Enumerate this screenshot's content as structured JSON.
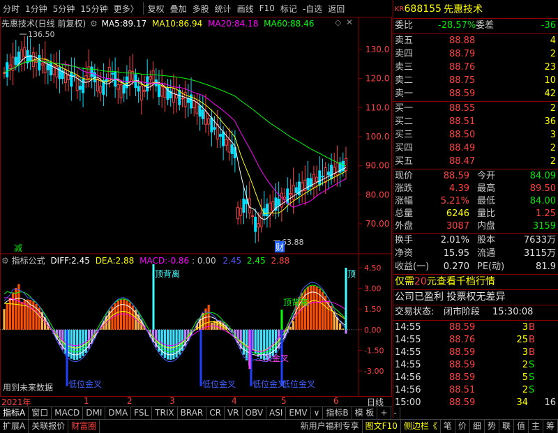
{
  "toolbar": {
    "items": [
      "分时",
      "1分钟",
      "5分钟",
      "15分钟",
      "更多〉",
      "复权",
      "叠加",
      "多股",
      "统计",
      "画线",
      "F10",
      "标记",
      "-自选",
      "返回"
    ],
    "colors": {
      "bg": "#000000",
      "border": "#8b0000"
    }
  },
  "main_chart": {
    "title": "先惠技术(日线 前复权)",
    "ma": [
      {
        "label": "MA5:",
        "value": "89.17",
        "color": "#ffffff"
      },
      {
        "label": "MA10:",
        "value": "86.94",
        "color": "#ffff00"
      },
      {
        "label": "MA20:",
        "value": "84.18",
        "color": "#ff00ff"
      },
      {
        "label": "MA60:",
        "value": "88.46",
        "color": "#00ff00"
      }
    ],
    "y_ticks": [
      "130.0",
      "120.0",
      "110.0",
      "100.0",
      "90.00",
      "80.00",
      "70.00"
    ],
    "high_label": "136.50",
    "low_label": "63.88",
    "marker_jian": "减",
    "marker_cai": "财"
  },
  "indicator": {
    "name": "指标公式",
    "diff_label": "DIFF:",
    "diff": "2.45",
    "dea_label": "DEA:",
    "dea": "2.88",
    "macd_label": "MACD:",
    "macd": "-0.86",
    "zero": ":  0.00",
    "v1": "2.45",
    "v2": "2.45",
    "v3": "2.88",
    "y_ticks": [
      "4.50",
      "3.00",
      "1.50",
      "0.00",
      "-1.50",
      "-3.00"
    ],
    "labels": {
      "top_div1": "顶背离",
      "top_div2": "顶背离",
      "top_div3": "顶",
      "low_gold1": "低位金叉",
      "low_gold2": "低位金叉",
      "low_gold3": "低位金叉",
      "low_gold4": "低位金叉",
      "second_gold": "二次金叉",
      "future_note": "用到未来数据"
    }
  },
  "time_axis": {
    "year": "2021年",
    "months": [
      "1",
      "2",
      "3",
      "4",
      "5",
      "6"
    ],
    "period": "日线"
  },
  "tabs_row1": [
    "指标A",
    "窗口",
    "MACD",
    "DMI",
    "DMA",
    "FSL",
    "TRIX",
    "BRAR",
    "CR",
    "VR",
    "OBV",
    "ASI",
    "EMV",
    "∨",
    "指标B",
    "模 板",
    "+",
    "-"
  ],
  "tabs_row2": [
    "扩展A",
    "关联报价",
    "财富圈",
    "新用户福利专享",
    "图文F10",
    "侧边栏《",
    "笔",
    "价",
    "细",
    "势",
    "联",
    "值",
    "主",
    "筹"
  ],
  "stock": {
    "kr": "KR",
    "code": "688155",
    "name": "先惠技术"
  },
  "weibi": {
    "label1": "委比",
    "val1": "-28.57%",
    "label2": "委差",
    "val2": "-36"
  },
  "asks": [
    {
      "label": "卖五",
      "price": "88.88",
      "vol": "4"
    },
    {
      "label": "卖四",
      "price": "88.79",
      "vol": "2"
    },
    {
      "label": "卖三",
      "price": "88.76",
      "vol": "23"
    },
    {
      "label": "卖二",
      "price": "88.75",
      "vol": "10"
    },
    {
      "label": "卖一",
      "price": "88.59",
      "vol": "42"
    }
  ],
  "bids": [
    {
      "label": "买一",
      "price": "88.55",
      "vol": "2"
    },
    {
      "label": "买二",
      "price": "88.51",
      "vol": "36"
    },
    {
      "label": "买三",
      "price": "88.50",
      "vol": "3"
    },
    {
      "label": "买四",
      "price": "88.49",
      "vol": "2"
    },
    {
      "label": "买五",
      "price": "88.47",
      "vol": "2"
    }
  ],
  "quote": [
    {
      "l1": "现价",
      "v1": "88.59",
      "l2": "今开",
      "v2": "84.09",
      "c1": "#ff4040",
      "c2": "#00e600"
    },
    {
      "l1": "涨跌",
      "v1": "4.39",
      "l2": "最高",
      "v2": "89.50",
      "c1": "#ff4040",
      "c2": "#ff4040"
    },
    {
      "l1": "涨幅",
      "v1": "5.21%",
      "l2": "最低",
      "v2": "84.00",
      "c1": "#ff4040",
      "c2": "#00e600"
    },
    {
      "l1": "总量",
      "v1": "6246",
      "l2": "量比",
      "v2": "1.25",
      "c1": "#ffff00",
      "c2": "#ff4040"
    },
    {
      "l1": "外盘",
      "v1": "3087",
      "l2": "内盘",
      "v2": "3159",
      "c1": "#ff4040",
      "c2": "#00e600"
    }
  ],
  "fund": [
    {
      "l1": "换手",
      "v1": "2.01%",
      "l2": "股本",
      "v2": "7633万"
    },
    {
      "l1": "净资",
      "v1": "15.95",
      "l2": "流通",
      "v2": "3115万"
    },
    {
      "l1": "收益(一)",
      "v1": "0.270",
      "l2": "PE(动)",
      "v2": "81.9"
    }
  ],
  "promo": {
    "pre": "仅需",
    "num": "20",
    "post": "元查看千档行情"
  },
  "profit_line": "公司已盈利 投票权无差异",
  "trade_state": {
    "label": "交易状态:",
    "state": "闭市阶段",
    "time": "15:30:08"
  },
  "ticks": [
    {
      "time": "14:55",
      "price": "88.59",
      "vol": "3",
      "side": "B"
    },
    {
      "time": "14:55",
      "price": "88.76",
      "vol": "25",
      "side": "B"
    },
    {
      "time": "14:55",
      "price": "88.59",
      "vol": "3",
      "side": "B"
    },
    {
      "time": "14:55",
      "price": "88.59",
      "vol": "2",
      "side": "S"
    },
    {
      "time": "14:56",
      "price": "88.59",
      "vol": "5",
      "side": "S"
    },
    {
      "time": "14:56",
      "price": "88.51",
      "vol": "2",
      "side": "S"
    },
    {
      "time": "15:00",
      "price": "88.59",
      "vol": "34",
      "side": ""
    }
  ],
  "last_tick_extra": "16"
}
